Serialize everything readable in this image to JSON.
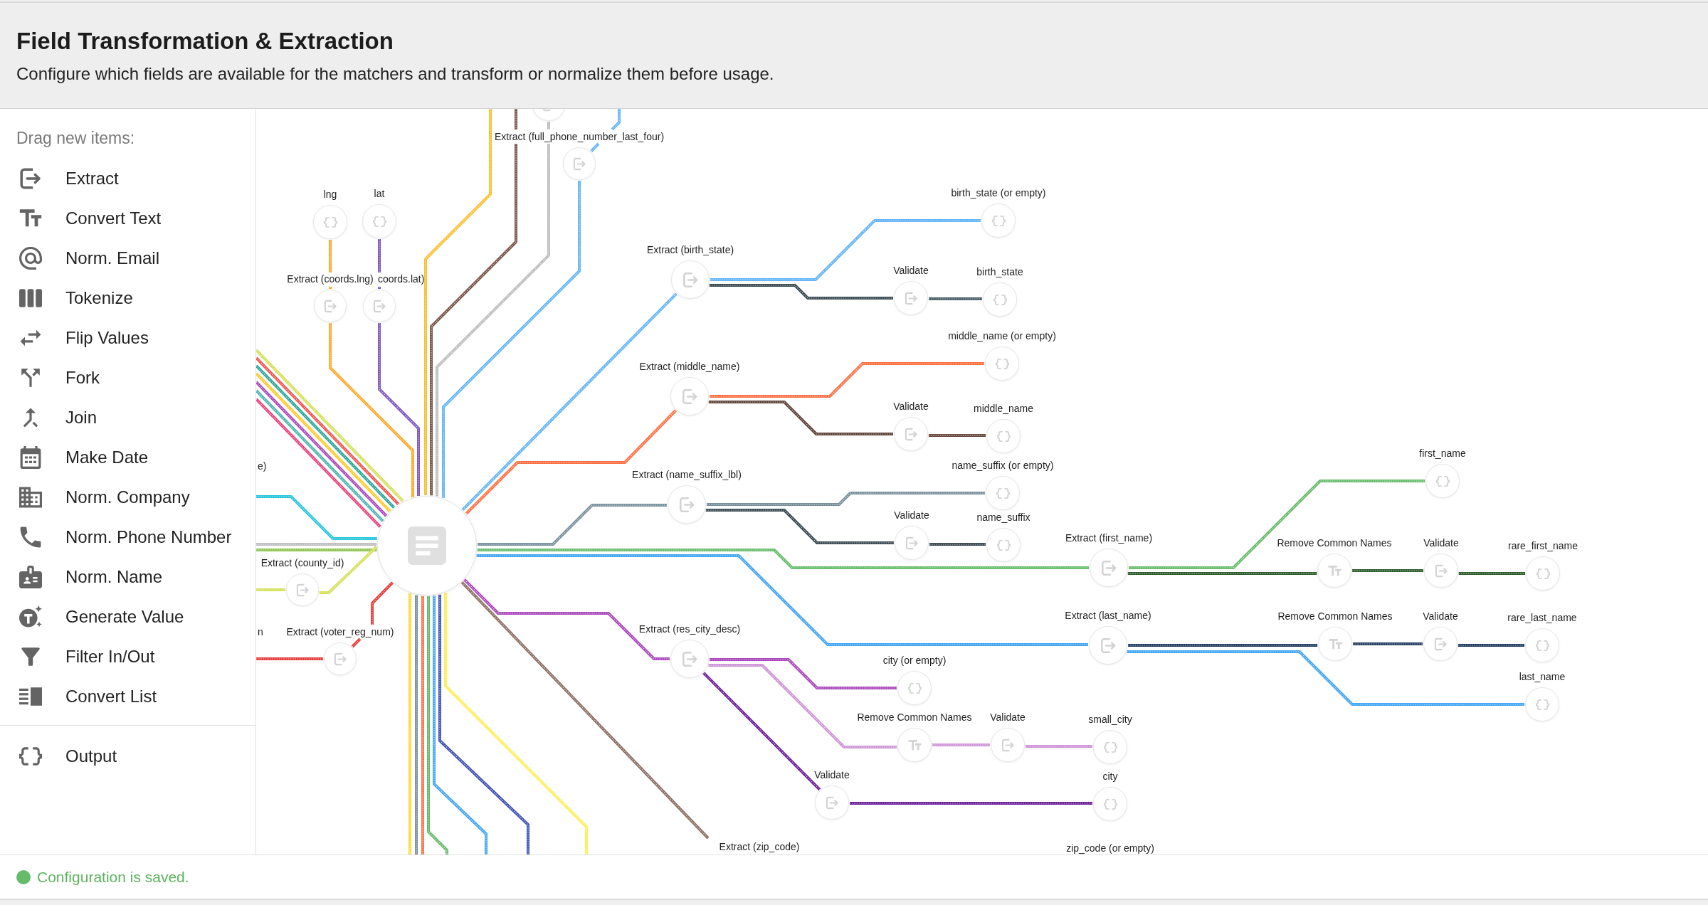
{
  "header": {
    "title": "Field Transformation & Extraction",
    "subtitle": "Configure which fields are available for the matchers and transform or normalize them before usage."
  },
  "palette": {
    "heading": "Drag new items:",
    "groups": [
      {
        "items": [
          "Extract",
          "Convert Text",
          "Norm. Email",
          "Tokenize",
          "Flip Values",
          "Fork",
          "Join",
          "Make Date",
          "Norm. Company",
          "Norm. Phone Number",
          "Norm. Name",
          "Generate Value",
          "Filter In/Out",
          "Convert List"
        ]
      },
      {
        "items": [
          "Output"
        ]
      }
    ]
  },
  "canvas": {
    "nodes": [
      {
        "kind": "extract"
      },
      {
        "kind": "extract",
        "label": "Extract (full_phone_number_last_four)"
      },
      {
        "kind": "output",
        "label": "lng"
      },
      {
        "kind": "output",
        "label": "lat"
      },
      {
        "kind": "extract",
        "label": "Extract (coords.lng)"
      },
      {
        "kind": "extract",
        "label": "coords.lat)"
      },
      {
        "kind": "extract",
        "label": "Extract (birth_state)"
      },
      {
        "kind": "output",
        "label": "birth_state (or empty)"
      },
      {
        "kind": "validate",
        "label": "Validate"
      },
      {
        "kind": "output",
        "label": "birth_state"
      },
      {
        "kind": "output",
        "label": "middle_name (or empty)"
      },
      {
        "kind": "extract",
        "label": "Extract (middle_name)"
      },
      {
        "kind": "validate",
        "label": "Validate"
      },
      {
        "kind": "output",
        "label": "middle_name"
      },
      {
        "kind": "output",
        "label": "name_suffix (or empty)"
      },
      {
        "kind": "extract",
        "label": "Extract (name_suffix_lbl)"
      },
      {
        "kind": "validate",
        "label": "Validate"
      },
      {
        "kind": "output",
        "label": "name_suffix"
      },
      {
        "kind": "output",
        "label": "first_name"
      },
      {
        "kind": "extract",
        "label": "Extract (first_name)"
      },
      {
        "kind": "convert",
        "label": "Remove Common Names"
      },
      {
        "kind": "validate",
        "label": "Validate"
      },
      {
        "kind": "output",
        "label": "rare_first_name"
      },
      {
        "kind": "extract",
        "label": "Extract (county_id)"
      },
      {
        "kind": "extract",
        "label": "Extract (last_name)"
      },
      {
        "kind": "convert",
        "label": "Remove Common Names"
      },
      {
        "kind": "validate",
        "label": "Validate"
      },
      {
        "kind": "output",
        "label": "rare_last_name"
      },
      {
        "kind": "extract",
        "label": "Extract (voter_reg_num)"
      },
      {
        "kind": "extract",
        "label": "Extract (res_city_desc)"
      },
      {
        "kind": "output",
        "label": "city (or empty)"
      },
      {
        "kind": "output",
        "label": "last_name"
      },
      {
        "kind": "convert",
        "label": "Remove Common Names"
      },
      {
        "kind": "validate",
        "label": "Validate"
      },
      {
        "kind": "output",
        "label": "small_city"
      },
      {
        "kind": "validate",
        "label": "Validate"
      },
      {
        "kind": "output",
        "label": "city"
      }
    ],
    "clipped_labels": [
      "e)",
      "n",
      "Extract (zip_code)",
      "zip_code (or empty)"
    ]
  },
  "status_bar": {
    "message": "Configuration is saved.",
    "saved": true
  }
}
